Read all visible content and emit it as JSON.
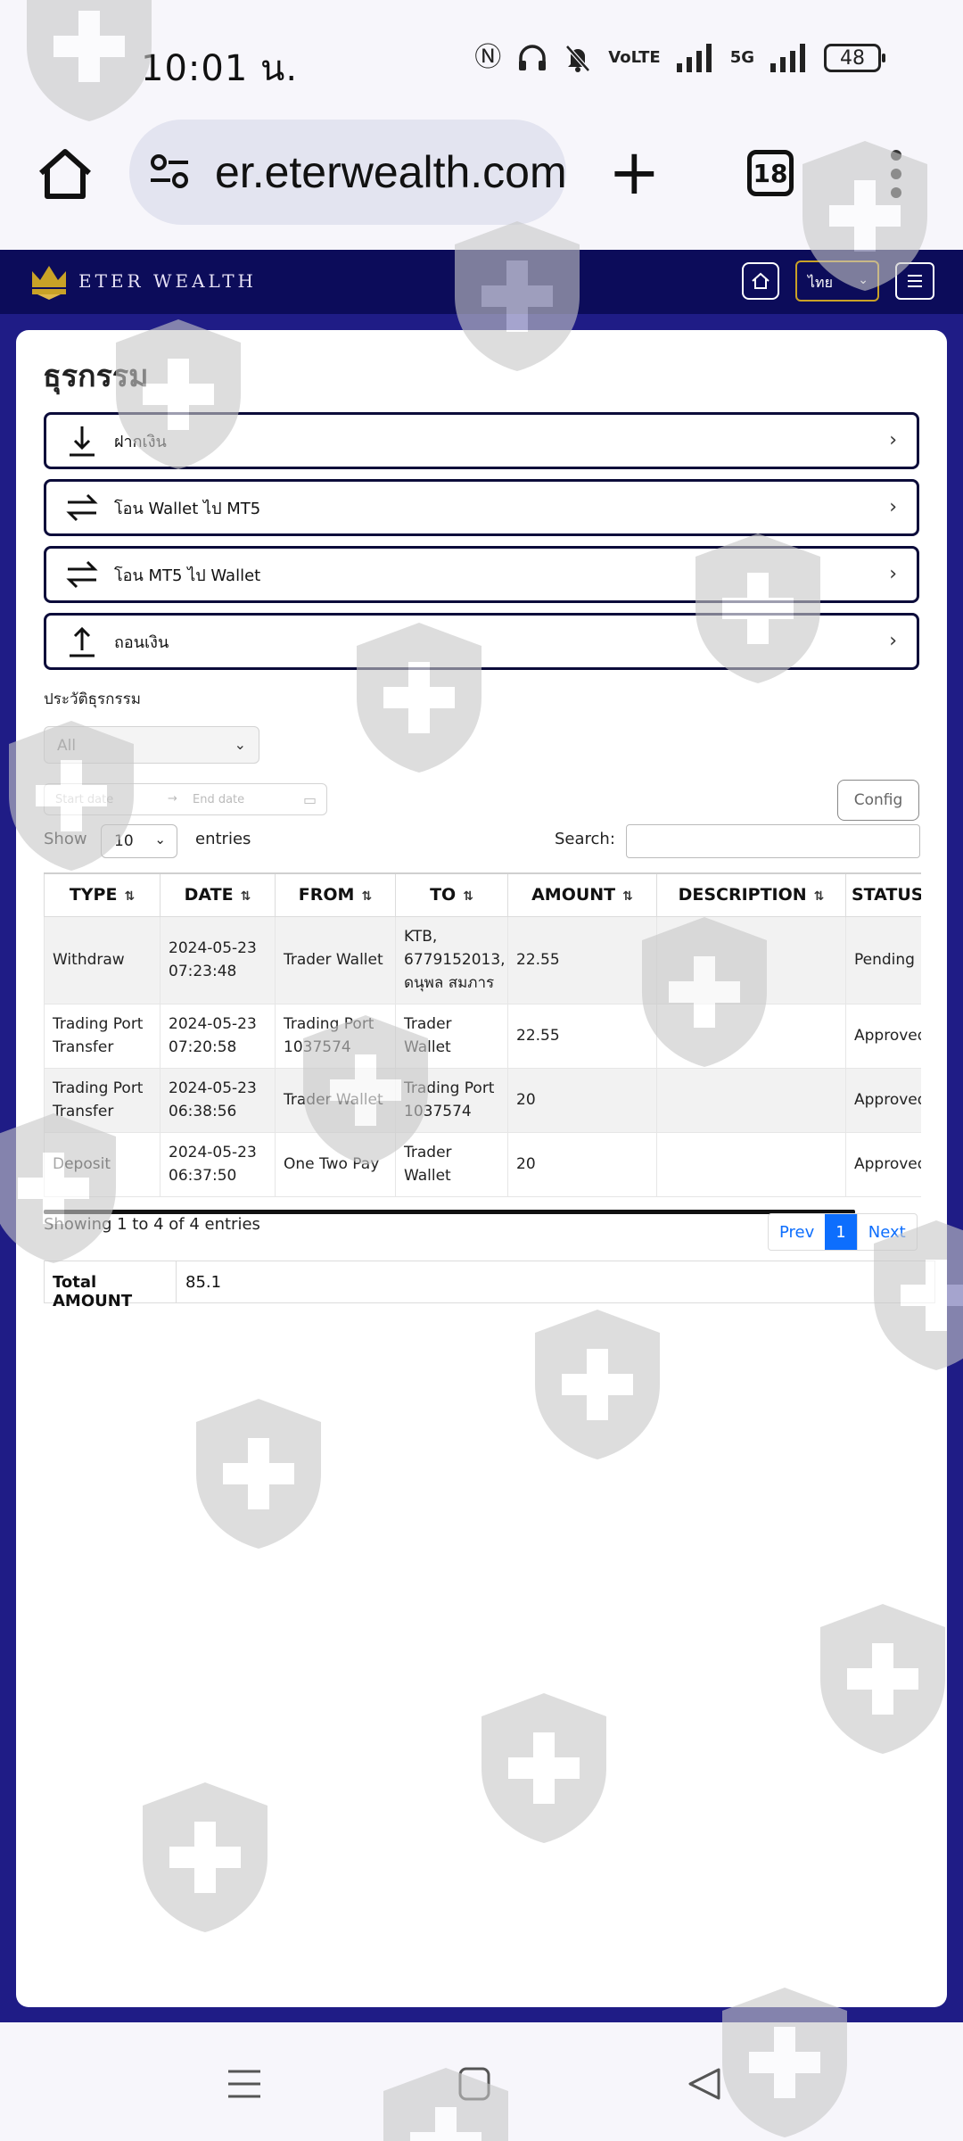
{
  "status_bar": {
    "time": "10:01 น.",
    "network": "5G",
    "battery": "48"
  },
  "browser": {
    "url": "er.eterwealth.com",
    "tab_count": "18"
  },
  "site_header": {
    "brand": "ETER WEALTH",
    "language": "ไทย"
  },
  "page": {
    "title": "ธุรกรรม",
    "actions": [
      {
        "label": "ฝากเงิน",
        "icon": "download-icon"
      },
      {
        "label": "โอน Wallet ไป MT5",
        "icon": "transfer-arrows-icon"
      },
      {
        "label": "โอน MT5 ไป Wallet",
        "icon": "transfer-arrows-icon"
      },
      {
        "label": "ถอนเงิน",
        "icon": "upload-icon"
      }
    ],
    "history_label": "ประวัติธุรกรรม",
    "filter_value": "All",
    "date_start_placeholder": "Start date",
    "date_end_placeholder": "End date",
    "config_label": "Config"
  },
  "table": {
    "show_label": "Show",
    "page_length": "10",
    "entries_label": "entries",
    "search_label": "Search:",
    "columns": [
      "TYPE",
      "DATE",
      "FROM",
      "TO",
      "AMOUNT",
      "DESCRIPTION",
      "STATUS"
    ],
    "rows": [
      {
        "type": "Withdraw",
        "date": "2024-05-23 07:23:48",
        "from": "Trader Wallet",
        "to": "KTB, 6779152013, ดนุพล สมภาร",
        "amount": "22.55",
        "description": "",
        "status": "Pending"
      },
      {
        "type": "Trading Port Transfer",
        "date": "2024-05-23 07:20:58",
        "from": "Trading Port 1037574",
        "to": "Trader Wallet",
        "amount": "22.55",
        "description": "",
        "status": "Approved"
      },
      {
        "type": "Trading Port Transfer",
        "date": "2024-05-23 06:38:56",
        "from": "Trader Wallet",
        "to": "Trading Port 1037574",
        "amount": "20",
        "description": "",
        "status": "Approved"
      },
      {
        "type": "Deposit",
        "date": "2024-05-23 06:37:50",
        "from": "One Two Pay",
        "to": "Trader Wallet",
        "amount": "20",
        "description": "",
        "status": "Approved"
      }
    ],
    "info": "Showing 1 to 4 of 4 entries",
    "pagination": {
      "prev": "Prev",
      "current": "1",
      "next": "Next"
    }
  },
  "total": {
    "label": "Total AMOUNT",
    "value": "85.1"
  },
  "colors": {
    "header_navy": "#0c0c5a",
    "page_band": "#1f1c86",
    "pager_blue": "#0d6efd",
    "logo_gold": "#c9a227"
  }
}
